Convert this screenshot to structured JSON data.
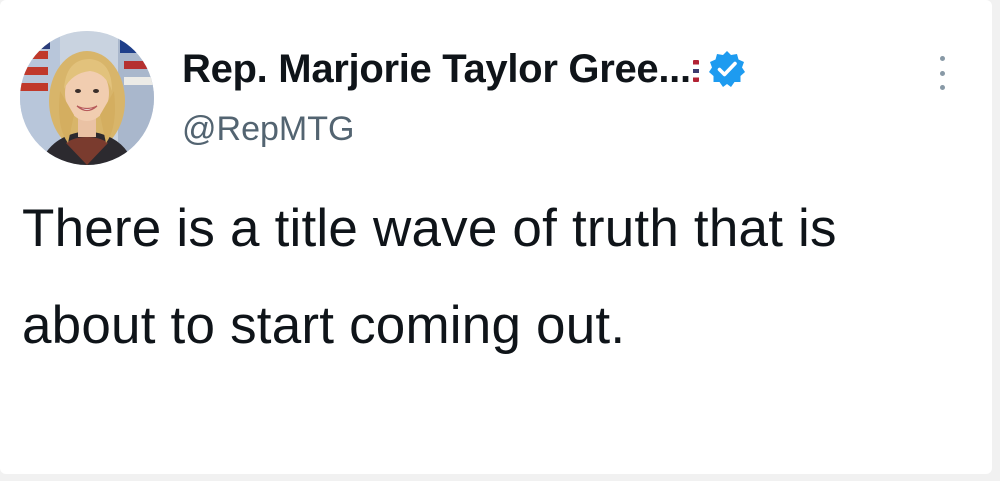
{
  "tweet": {
    "author": {
      "display_name": "Rep. Marjorie Taylor Gree...",
      "handle": "@RepMTG",
      "verified": true,
      "avatar_icon": "profile-photo"
    },
    "text": "There is a title wave of truth that is about to start coming out."
  },
  "colors": {
    "verified_blue": "#1d9bf0",
    "text_primary": "#0f1419",
    "text_secondary": "#536471"
  }
}
